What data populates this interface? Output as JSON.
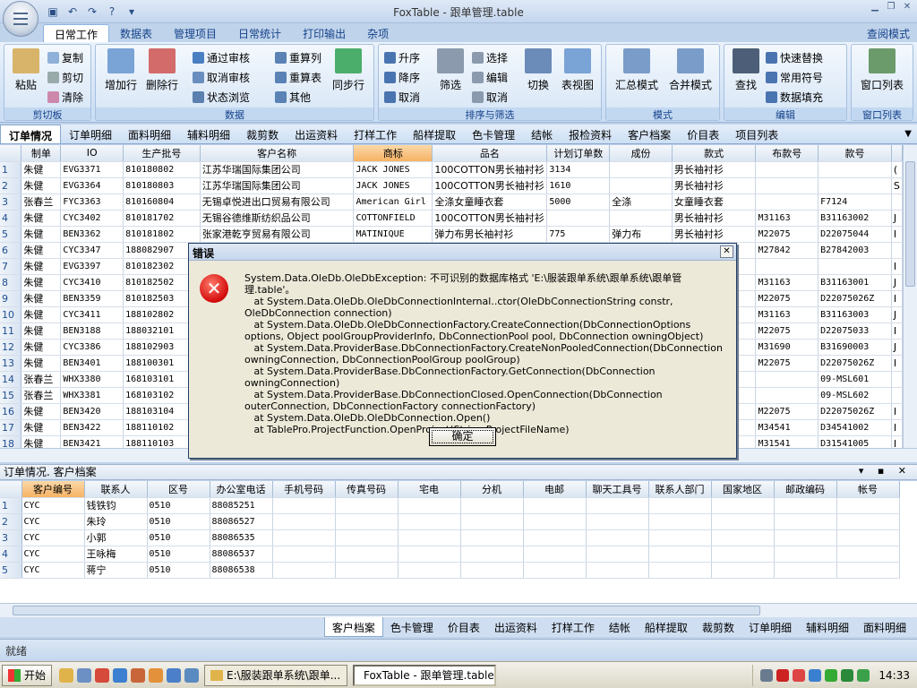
{
  "window": {
    "title": "FoxTable - 跟单管理.table"
  },
  "ribbon": {
    "tabs": [
      "日常工作",
      "数据表",
      "管理项目",
      "日常统计",
      "打印输出",
      "杂项"
    ],
    "right_tab": "查阅模式",
    "clipboard": {
      "paste": "粘贴",
      "copy": "复制",
      "cut": "剪切",
      "clear": "清除",
      "label": "剪切板"
    },
    "data": {
      "add_row": "增加行",
      "del_row": "删除行",
      "approve": "通过审核",
      "unapprove": "取消审核",
      "state_browse": "状态浏览",
      "recalc_col": "重算列",
      "recalc_table": "重算表",
      "other": "其他",
      "sync_row": "同步行",
      "label": "数据"
    },
    "sort": {
      "asc": "升序",
      "desc": "降序",
      "cancel": "取消",
      "filter": "筛选",
      "select": "选择",
      "edit": "编辑",
      "cancel2": "取消",
      "switch": "切换",
      "table_view": "表视图",
      "label": "排序与筛选"
    },
    "mode": {
      "summary": "汇总模式",
      "merge": "合并模式",
      "label": "模式"
    },
    "edit": {
      "find": "查找",
      "quick_replace": "快速替换",
      "common_symbols": "常用符号",
      "data_fill": "数据填充",
      "label": "编辑"
    },
    "winlist": {
      "btn": "窗口列表",
      "label": "窗口列表"
    }
  },
  "sheet_tabs": [
    "订单情况",
    "订单明细",
    "面料明细",
    "辅料明细",
    "裁剪数",
    "出运资料",
    "打样工作",
    "船样提取",
    "色卡管理",
    "结帐",
    "报检资料",
    "客户档案",
    "价目表",
    "项目列表"
  ],
  "main_grid": {
    "columns": [
      "制单",
      "IO",
      "生产批号",
      "客户名称",
      "商标",
      "品名",
      "计划订单数",
      "成份",
      "款式",
      "布款号",
      "款号"
    ],
    "rows": [
      [
        "1",
        "朱健",
        "EVG3371",
        "810180802",
        "江苏华瑞国际集团公司",
        "JACK JONES",
        "100COTTON男长袖衬衫",
        "3134",
        "",
        "男长袖衬衫",
        "",
        "",
        "("
      ],
      [
        "2",
        "朱健",
        "EVG3364",
        "810180803",
        "江苏华瑞国际集团公司",
        "JACK JONES",
        "100COTTON男长袖衬衫",
        "1610",
        "",
        "男长袖衬衫",
        "",
        "",
        "S"
      ],
      [
        "3",
        "张春兰",
        "FYC3363",
        "810160804",
        "无锡卓悦进出口贸易有限公司",
        "American Girl",
        "全涤女童睡衣套",
        "5000",
        "全涤",
        "女童睡衣套",
        "",
        "F7124",
        ""
      ],
      [
        "4",
        "朱健",
        "CYC3402",
        "810181702",
        "无锡谷德维斯纺织品公司",
        "COTTONFIELD",
        "100COTTON男长袖衬衫",
        "",
        "",
        "男长袖衬衫",
        "M31163",
        "B31163002",
        "J"
      ],
      [
        "5",
        "朱健",
        "BEN3362",
        "810181802",
        "张家港乾亨贸易有限公司",
        "MATINIQUE",
        "弹力布男长袖衬衫",
        "775",
        "弹力布",
        "男长袖衬衫",
        "M22075",
        "D22075044",
        "I"
      ],
      [
        "6",
        "朱健",
        "CYC3347",
        "188082907",
        "",
        "",
        "",
        "",
        "",
        "",
        "M27842",
        "B27842003",
        ""
      ],
      [
        "7",
        "朱健",
        "EVG3397",
        "810182302",
        "",
        "",
        "",
        "",
        "",
        "",
        "",
        "",
        "I"
      ],
      [
        "8",
        "朱健",
        "CYC3410",
        "810182502",
        "",
        "",
        "",
        "",
        "",
        "",
        "M31163",
        "B31163001",
        "J"
      ],
      [
        "9",
        "朱健",
        "BEN3359",
        "810182503",
        "",
        "",
        "",
        "",
        "",
        "",
        "M22075",
        "D22075026Z",
        "I"
      ],
      [
        "10",
        "朱健",
        "CYC3411",
        "188102802",
        "",
        "",
        "",
        "",
        "",
        "",
        "M31163",
        "B31163003",
        "J"
      ],
      [
        "11",
        "朱健",
        "BEN3188",
        "188032101",
        "",
        "",
        "",
        "",
        "",
        "",
        "M22075",
        "D22075033",
        "I"
      ],
      [
        "12",
        "朱健",
        "CYC3386",
        "188102903",
        "",
        "",
        "",
        "",
        "",
        "",
        "M31690",
        "B31690003",
        "J"
      ],
      [
        "13",
        "朱健",
        "BEN3401",
        "188100301",
        "",
        "",
        "",
        "",
        "",
        "",
        "M22075",
        "D22075026Z",
        "I"
      ],
      [
        "14",
        "张春兰",
        "WHX3380",
        "168103101",
        "",
        "",
        "",
        "",
        "",
        "",
        "",
        "09-MSL601",
        ""
      ],
      [
        "15",
        "张春兰",
        "WHX3381",
        "168103102",
        "",
        "",
        "",
        "",
        "",
        "",
        "",
        "09-MSL602",
        ""
      ],
      [
        "16",
        "朱健",
        "BEN3420",
        "188103104",
        "",
        "",
        "",
        "",
        "",
        "",
        "M22075",
        "D22075026Z",
        "I"
      ],
      [
        "17",
        "朱健",
        "BEN3422",
        "188110102",
        "",
        "",
        "",
        "",
        "",
        "",
        "M34541",
        "D34541002",
        "I"
      ],
      [
        "18",
        "朱健",
        "BEN3421",
        "188110103",
        "",
        "",
        "",
        "",
        "",
        "",
        "M31541",
        "D31541005",
        "I"
      ]
    ]
  },
  "pane": {
    "title": "订单情况. 客户档案",
    "controls": "▾ ▪ ✕"
  },
  "sub_grid": {
    "columns": [
      "客户编号",
      "联系人",
      "区号",
      "办公室电话",
      "手机号码",
      "传真号码",
      "宅电",
      "分机",
      "电邮",
      "聊天工具号",
      "联系人部门",
      "国家地区",
      "邮政编码",
      "帐号"
    ],
    "rows": [
      [
        "1",
        "CYC",
        "钱铁钧",
        "0510",
        "88085251"
      ],
      [
        "2",
        "CYC",
        "朱玲",
        "0510",
        "88086527"
      ],
      [
        "3",
        "CYC",
        "小郭",
        "0510",
        "88086535"
      ],
      [
        "4",
        "CYC",
        "王咏梅",
        "0510",
        "88086537"
      ],
      [
        "5",
        "CYC",
        "蒋宁",
        "0510",
        "88086538"
      ]
    ]
  },
  "bottom_tabs": [
    "客户档案",
    "色卡管理",
    "价目表",
    "出运资料",
    "打样工作",
    "结帐",
    "船样提取",
    "裁剪数",
    "订单明细",
    "辅料明细",
    "面料明细"
  ],
  "status": {
    "text": "就绪"
  },
  "dialog": {
    "title": "错误",
    "message": "System.Data.OleDb.OleDbException: 不可识别的数据库格式 'E:\\服装跟单系统\\跟单系统\\跟单管理.table'。\n   at System.Data.OleDb.OleDbConnectionInternal..ctor(OleDbConnectionString constr, OleDbConnection connection)\n   at System.Data.OleDb.OleDbConnectionFactory.CreateConnection(DbConnectionOptions options, Object poolGroupProviderInfo, DbConnectionPool pool, DbConnection owningObject)\n   at System.Data.ProviderBase.DbConnectionFactory.CreateNonPooledConnection(DbConnection owningConnection, DbConnectionPoolGroup poolGroup)\n   at System.Data.ProviderBase.DbConnectionFactory.GetConnection(DbConnection owningConnection)\n   at System.Data.ProviderBase.DbConnectionClosed.OpenConnection(DbConnection outerConnection, DbConnectionFactory connectionFactory)\n   at System.Data.OleDb.OleDbConnection.Open()\n   at TablePro.ProjectFunction.OpenProject(String ProjectFileName)",
    "ok": "确定"
  },
  "taskbar": {
    "start": "开始",
    "task1": "E:\\服装跟单系统\\跟单...",
    "task2": "FoxTable - 跟单管理.table",
    "clock": "14:33"
  }
}
